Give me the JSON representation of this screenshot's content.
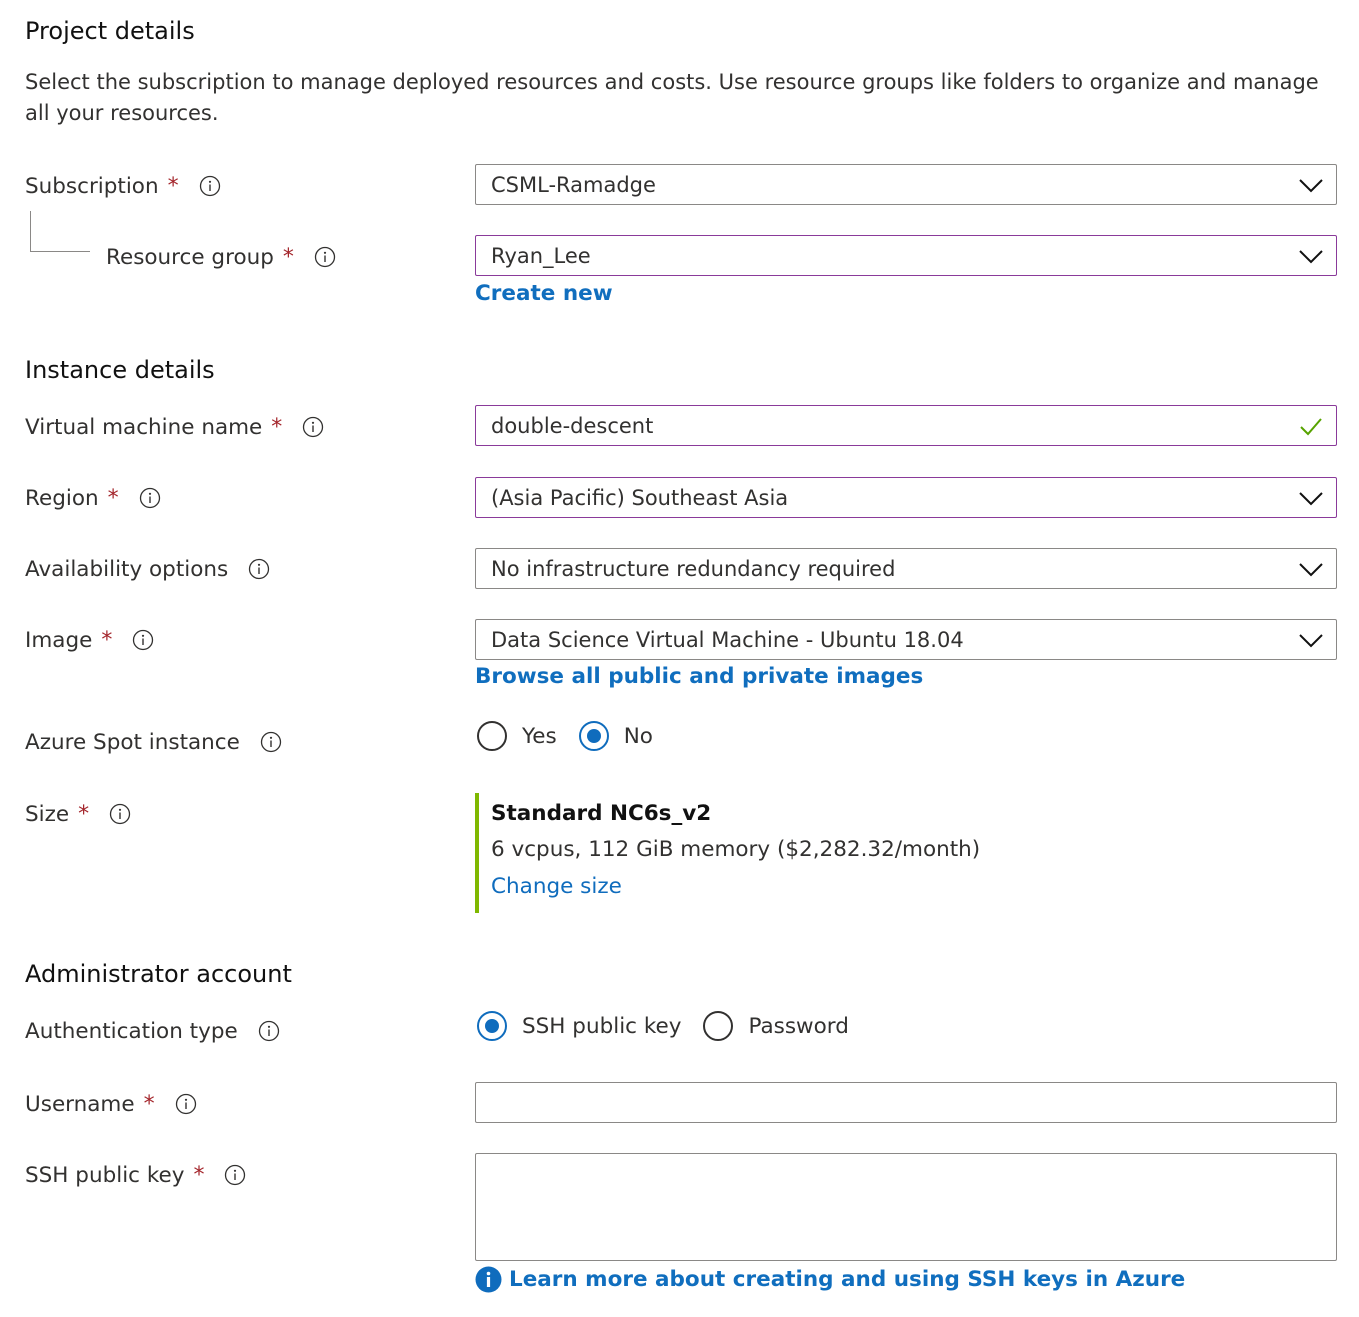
{
  "project": {
    "title": "Project details",
    "description": "Select the subscription to manage deployed resources and costs. Use resource groups like folders to organize and manage all your resources.",
    "subscription": {
      "label": "Subscription",
      "value": "CSML-Ramadge"
    },
    "resource_group": {
      "label": "Resource group",
      "value": "Ryan_Lee",
      "create_new": "Create new"
    }
  },
  "instance": {
    "title": "Instance details",
    "vm_name": {
      "label": "Virtual machine name",
      "value": "double-descent"
    },
    "region": {
      "label": "Region",
      "value": "(Asia Pacific) Southeast Asia"
    },
    "availability": {
      "label": "Availability options",
      "value": "No infrastructure redundancy required"
    },
    "image": {
      "label": "Image",
      "value": "Data Science Virtual Machine - Ubuntu 18.04",
      "browse_link": "Browse all public and private images"
    },
    "spot": {
      "label": "Azure Spot instance",
      "options": [
        "Yes",
        "No"
      ],
      "selected": "No"
    },
    "size": {
      "label": "Size",
      "name": "Standard NC6s_v2",
      "spec": "6 vcpus, 112 GiB memory ($2,282.32/month)",
      "change_link": "Change size"
    }
  },
  "admin": {
    "title": "Administrator account",
    "auth_type": {
      "label": "Authentication type",
      "options": [
        "SSH public key",
        "Password"
      ],
      "selected": "SSH public key"
    },
    "username": {
      "label": "Username",
      "value": ""
    },
    "ssh_key": {
      "label": "SSH public key",
      "value": "",
      "learn_more": "Learn more about creating and using SSH keys in Azure"
    }
  },
  "required_marker": "*",
  "colors": {
    "accent": "#0f6cbd",
    "required": "#a4262c",
    "focus_border": "#8a3a9a",
    "valid": "#57a300",
    "size_bar": "#7fb800"
  }
}
